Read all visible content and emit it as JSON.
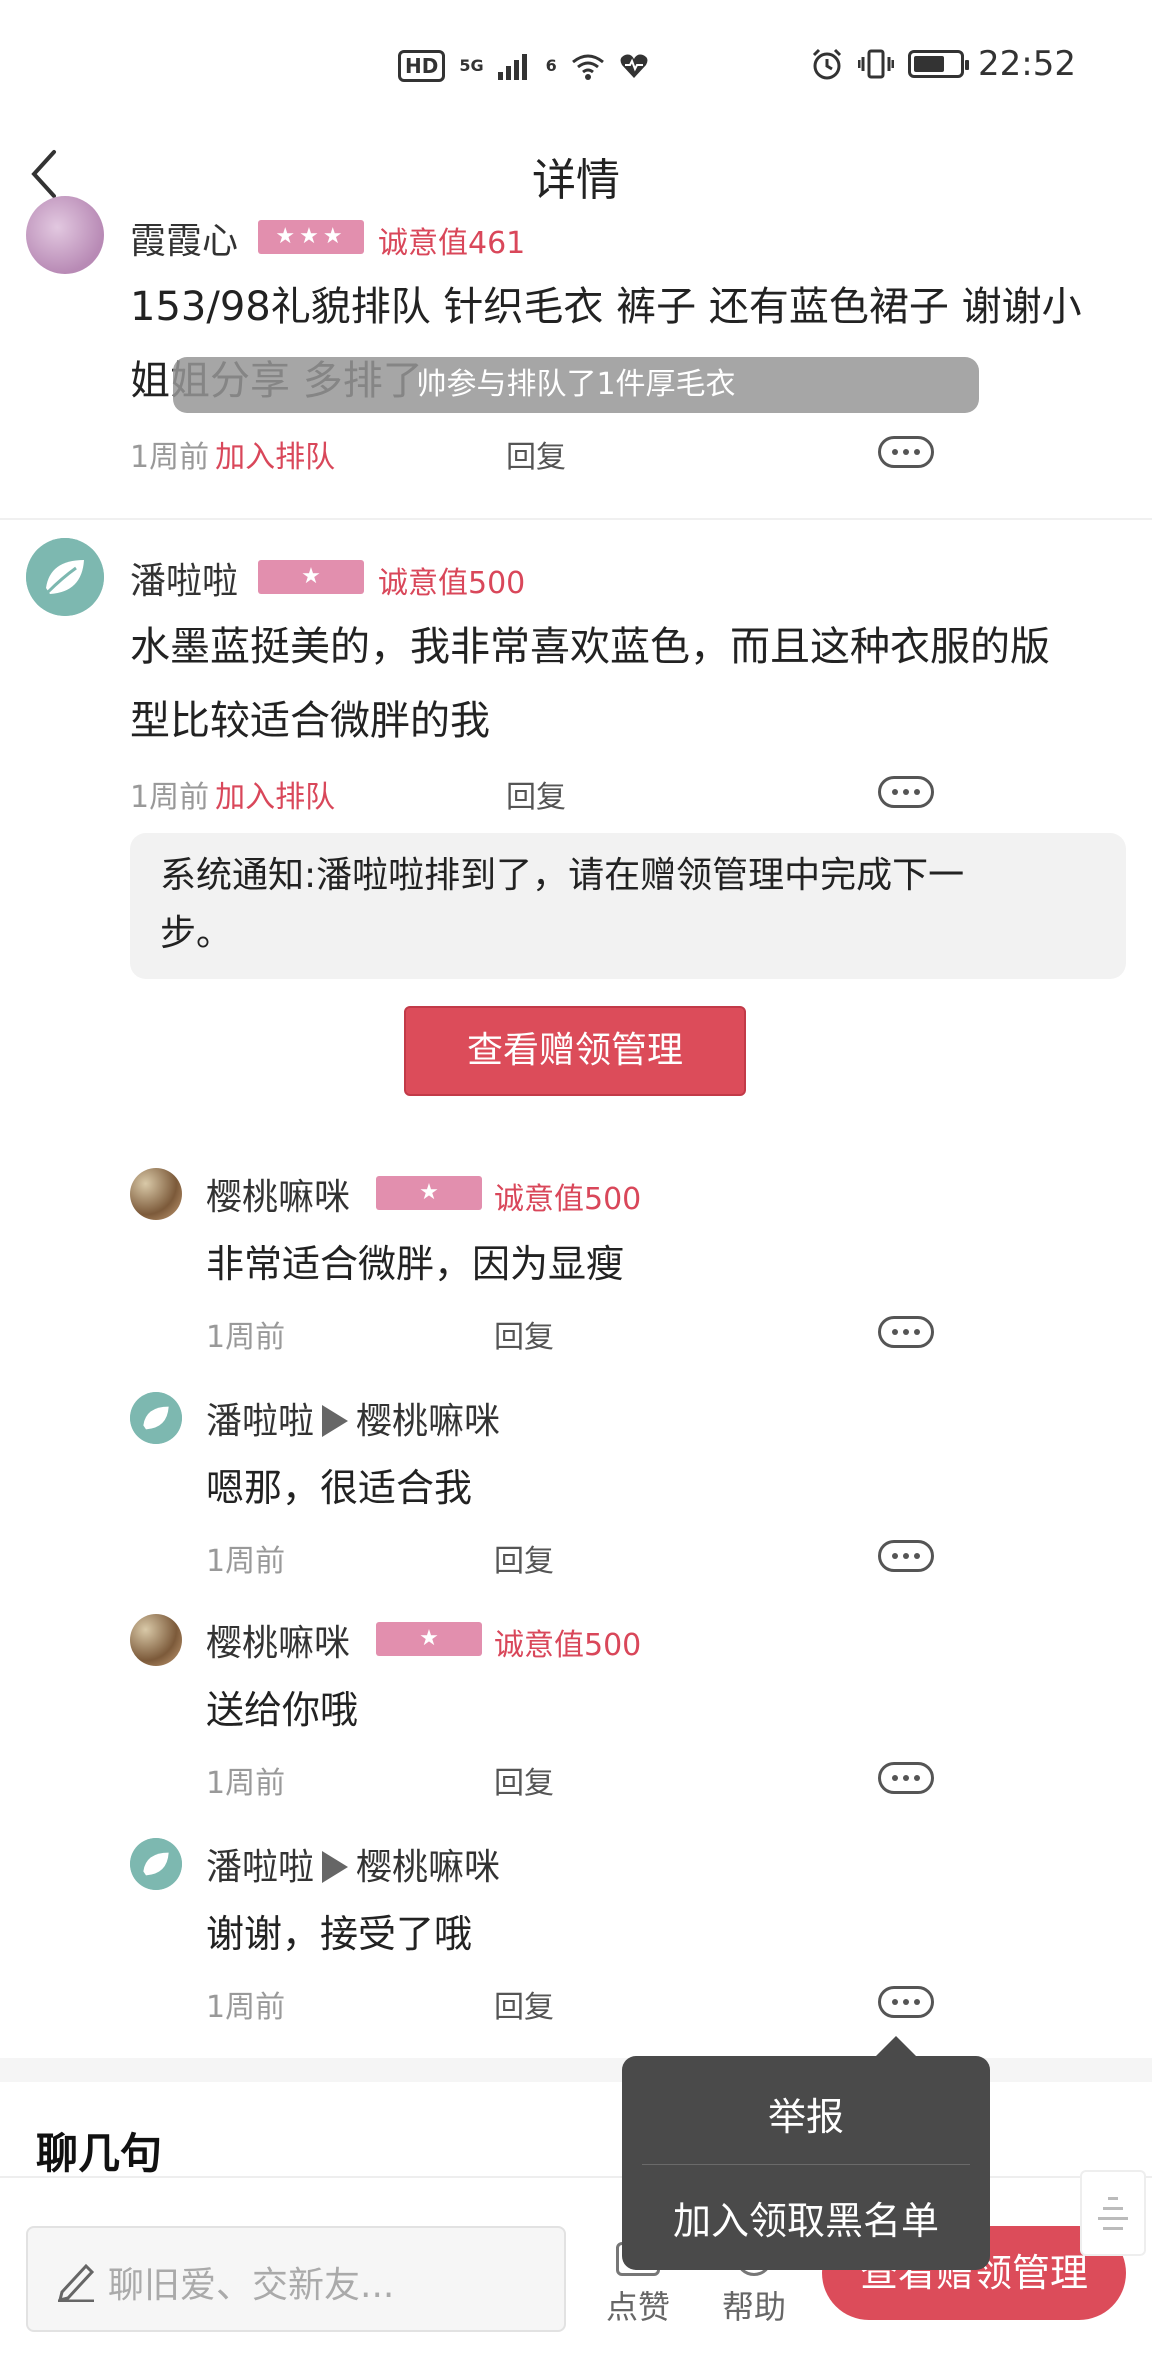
{
  "status_bar": {
    "hd": "HD",
    "net1": "5G",
    "net2": "6",
    "time": "22:52"
  },
  "nav": {
    "title": "详情"
  },
  "toast": "帅参与排队了1件厚毛衣",
  "comments": [
    {
      "name": "霞霞心",
      "badge": "★★★",
      "sincerity": "诚意值461",
      "text_line1": "153/98礼貌排队 针织毛衣 裤子 还有蓝色裙子 谢谢小",
      "text_line2": "姐姐分享 多排了",
      "time": "1周前",
      "join": "加入排队",
      "reply": "回复"
    },
    {
      "name": "潘啦啦",
      "badge": "★",
      "sincerity": "诚意值500",
      "text_line1": "水墨蓝挺美的，我非常喜欢蓝色，而且这种衣服的版",
      "text_line2": "型比较适合微胖的我",
      "time": "1周前",
      "join": "加入排队",
      "reply": "回复"
    }
  ],
  "system_notice": {
    "line1": "系统通知:潘啦啦排到了，请在赠领管理中完成下一",
    "line2": "步。"
  },
  "manage_button": "查看赠领管理",
  "replies": [
    {
      "name": "樱桃嘛咪",
      "badge": "★",
      "sincerity": "诚意值500",
      "text": "非常适合微胖，因为显瘦",
      "time": "1周前",
      "reply": "回复"
    },
    {
      "name": "潘啦啦",
      "to": "樱桃嘛咪",
      "text": "嗯那，很适合我",
      "time": "1周前",
      "reply": "回复"
    },
    {
      "name": "樱桃嘛咪",
      "badge": "★",
      "sincerity": "诚意值500",
      "text": "送给你哦",
      "time": "1周前",
      "reply": "回复"
    },
    {
      "name": "潘啦啦",
      "to": "樱桃嘛咪",
      "text": "谢谢，接受了哦",
      "time": "1周前",
      "reply": "回复"
    }
  ],
  "chat_heading": "聊几句",
  "bottom_bar": {
    "placeholder": "聊旧爱、交新友...",
    "like": "点赞",
    "help": "帮助",
    "manage": "查看赠领管理"
  },
  "popup": {
    "report": "举报",
    "blacklist": "加入领取黑名单"
  },
  "colors": {
    "accent": "#dc4c5a",
    "badge": "#e28fae"
  }
}
